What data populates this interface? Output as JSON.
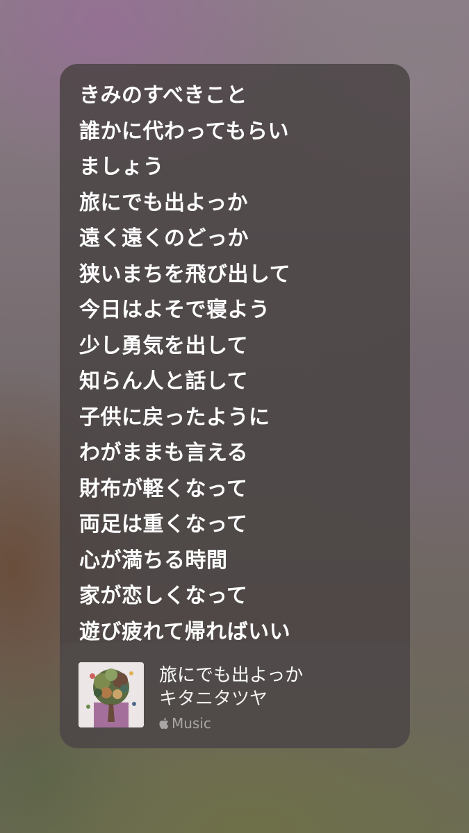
{
  "lyrics": {
    "lines": [
      "きみのすべきこと",
      "誰かに代わってもらい",
      "ましょう",
      "旅にでも出よっか",
      "遠く遠くのどっか",
      "狭いまちを飛び出して",
      "今日はよそで寝よう",
      "少し勇気を出して",
      "知らん人と話して",
      "子供に戻ったように",
      "わがままも言える",
      "財布が軽くなって",
      "両足は重くなって",
      "心が満ちる時間",
      "家が恋しくなって",
      "遊び疲れて帰ればいい"
    ]
  },
  "track": {
    "title": "旅にでも出よっか",
    "artist": "キタニタツヤ",
    "service": "Music",
    "service_icon": "apple-logo-icon",
    "artwork_icon": "album-artwork"
  }
}
